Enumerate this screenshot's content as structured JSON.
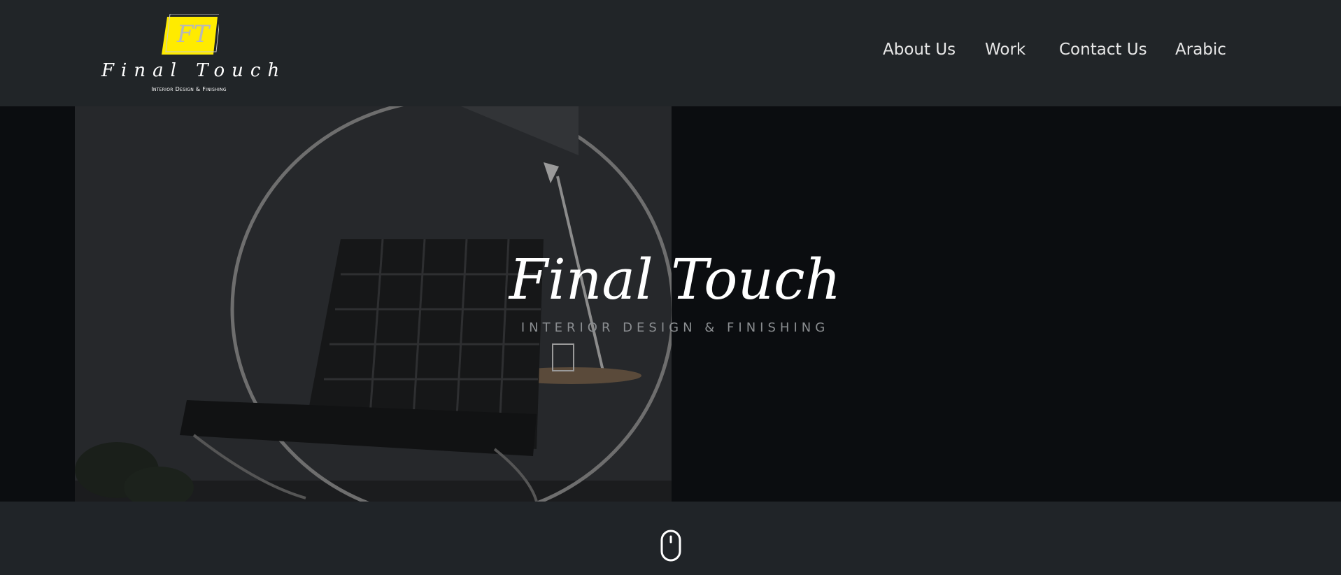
{
  "header": {
    "logo": {
      "monogram": "FT",
      "script": "Final Touch",
      "tagline": "Interior Design & Finishing",
      "accent_color": "#ffeb00"
    },
    "nav": [
      {
        "label": "About Us",
        "name": "nav-about-us"
      },
      {
        "label": "Work",
        "name": "nav-work"
      },
      {
        "label": "Contact Us",
        "name": "nav-contact-us"
      },
      {
        "label": "Arabic",
        "name": "nav-arabic"
      }
    ]
  },
  "hero": {
    "title": "Final Touch",
    "subtitle": "INTERIOR DESIGN & FINISHING"
  },
  "scroll_indicator": {
    "icon": "mouse-scroll-icon"
  },
  "colors": {
    "header_bg": "#212528",
    "hero_bg": "#0b0d10",
    "text": "#ffffff",
    "subtitle": "#8a8d90"
  }
}
